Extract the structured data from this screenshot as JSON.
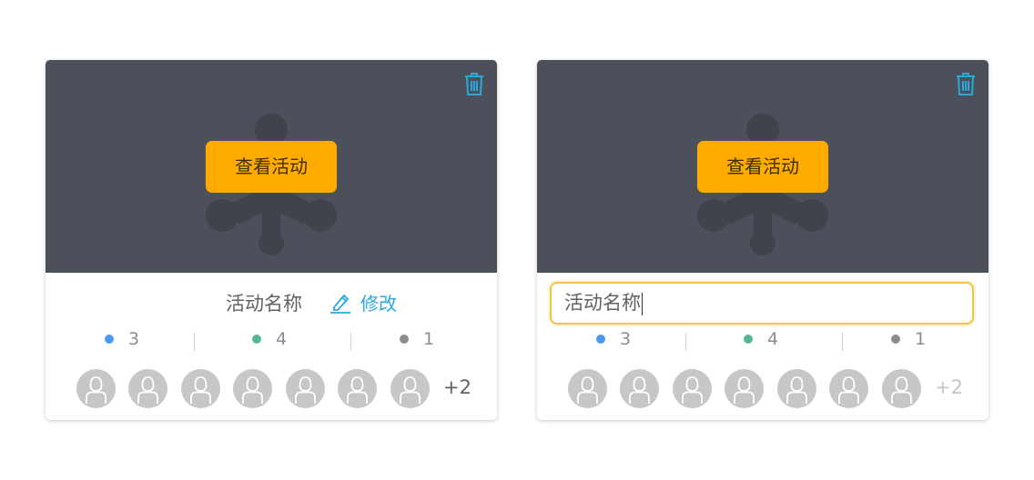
{
  "colors": {
    "cover_bg": "#4b505a",
    "accent": "#ffab00",
    "link": "#2aa8de",
    "input_focus_border": "#f6c343",
    "dot_blue": "#4a9bf0",
    "dot_green": "#55b894",
    "dot_gray": "#8c8c8c",
    "avatar_bg": "#c7c7c7"
  },
  "cards": [
    {
      "state": "display",
      "view_button_label": "查看活动",
      "trash_icon": "trash-icon",
      "activity_name": "活动名称",
      "edit_label": "修改",
      "edit_icon": "pencil-icon",
      "stats": [
        {
          "color": "blue",
          "count": "3"
        },
        {
          "color": "green",
          "count": "4"
        },
        {
          "color": "gray",
          "count": "1"
        }
      ],
      "avatar_icon": "user-avatar-icon",
      "avatar_count": 7,
      "more_label": "+2"
    },
    {
      "state": "editing",
      "view_button_label": "查看活动",
      "trash_icon": "trash-icon",
      "input_value": "活动名称",
      "stats": [
        {
          "color": "blue",
          "count": "3"
        },
        {
          "color": "green",
          "count": "4"
        },
        {
          "color": "gray",
          "count": "1"
        }
      ],
      "avatar_icon": "user-avatar-icon",
      "avatar_count": 7,
      "more_label": "+2"
    }
  ]
}
